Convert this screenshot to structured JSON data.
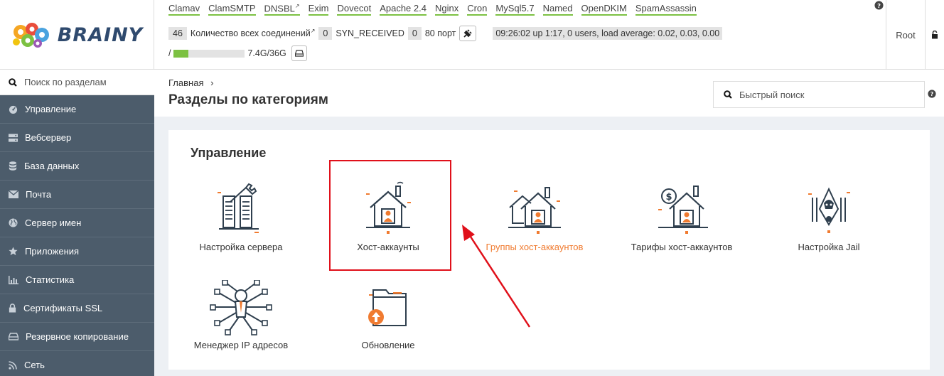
{
  "header": {
    "logo_text": "BRAINY",
    "services": [
      "Clamav",
      "ClamSMTP",
      "DNSBL",
      "Exim",
      "Dovecot",
      "Apache 2.4",
      "Nginx",
      "Cron",
      "MySql5.7",
      "Named",
      "OpenDKIM",
      "SpamAssassin"
    ],
    "stats": {
      "connections_count": "46",
      "connections_label": "Количество всех соединений",
      "syn_count": "0",
      "syn_label": "SYN_RECEIVED",
      "port_count": "0",
      "port_label": "80 порт",
      "uptime": "09:26:02 up 1:17, 0 users, load average: 0.02, 0.03, 0.00"
    },
    "disk": {
      "mount": "/",
      "usage": "7.4G/36G",
      "fill_fraction": 0.21
    },
    "user": "Root"
  },
  "sidebar": {
    "search_placeholder": "Поиск по разделам",
    "items": [
      {
        "label": "Управление",
        "icon": "dashboard-icon"
      },
      {
        "label": "Вебсервер",
        "icon": "server-icon"
      },
      {
        "label": "База данных",
        "icon": "database-icon"
      },
      {
        "label": "Почта",
        "icon": "envelope-icon"
      },
      {
        "label": "Сервер имен",
        "icon": "globe-icon"
      },
      {
        "label": "Приложения",
        "icon": "star-icon"
      },
      {
        "label": "Статистика",
        "icon": "bar-chart-icon"
      },
      {
        "label": "Сертификаты SSL",
        "icon": "lock-icon"
      },
      {
        "label": "Резервное копирование",
        "icon": "hdd-icon"
      },
      {
        "label": "Сеть",
        "icon": "rss-icon"
      }
    ]
  },
  "main": {
    "breadcrumb": "Главная",
    "breadcrumb_sep": "›",
    "title": "Разделы по категориям",
    "quick_search_placeholder": "Быстрый поиск",
    "section_title": "Управление",
    "tiles": [
      {
        "label": "Настройка сервера",
        "icon": "server-settings-icon"
      },
      {
        "label": "Хост-аккаунты",
        "icon": "host-account-icon"
      },
      {
        "label": "Группы хост-аккаунтов",
        "icon": "host-group-icon",
        "highlighted": true
      },
      {
        "label": "Тарифы хост-аккаунтов",
        "icon": "host-tariff-icon"
      },
      {
        "label": "Настройка Jail",
        "icon": "jail-icon"
      },
      {
        "label": "Менеджер IP адресов",
        "icon": "ip-manager-icon"
      },
      {
        "label": "Обновление",
        "icon": "update-folder-icon"
      }
    ]
  },
  "colors": {
    "accent_green": "#7cc142",
    "sidebar_bg": "#4c5c6b",
    "highlight_orange": "#f07b30",
    "annotation_red": "#e0101a",
    "icon_dark": "#2f3f4e"
  }
}
